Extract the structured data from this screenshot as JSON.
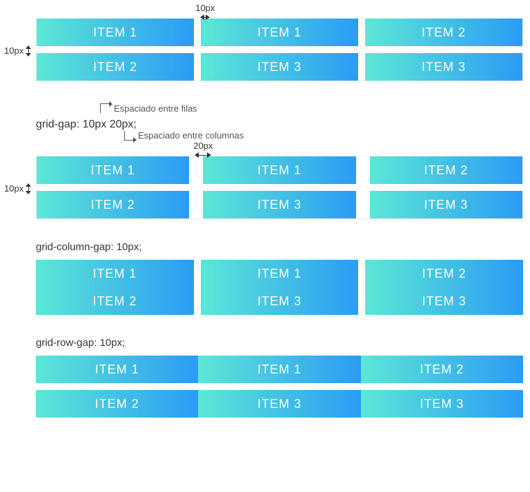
{
  "labels": {
    "h10": "10px",
    "v10": "10px",
    "h20": "20px"
  },
  "grids": {
    "a": {
      "items": [
        "ITEM 1",
        "ITEM 1",
        "ITEM 2",
        "ITEM 2",
        "ITEM 3",
        "ITEM 3"
      ]
    },
    "b": {
      "items": [
        "ITEM 1",
        "ITEM 1",
        "ITEM 2",
        "ITEM 2",
        "ITEM 3",
        "ITEM 3"
      ]
    },
    "c": {
      "items": [
        "ITEM 1",
        "ITEM 1",
        "ITEM 2",
        "ITEM 2",
        "ITEM 3",
        "ITEM 3"
      ]
    },
    "d": {
      "items": [
        "ITEM 1",
        "ITEM 1",
        "ITEM 2",
        "ITEM 2",
        "ITEM 3",
        "ITEM 3"
      ]
    }
  },
  "code": {
    "gridGap": "grid-gap: 10px 20px;",
    "colGap": "grid-column-gap: 10px;",
    "rowGap": "grid-row-gap: 10px;",
    "calloutRows": "Espaciado entre filas",
    "calloutCols": "Espaciado entre columnas"
  }
}
